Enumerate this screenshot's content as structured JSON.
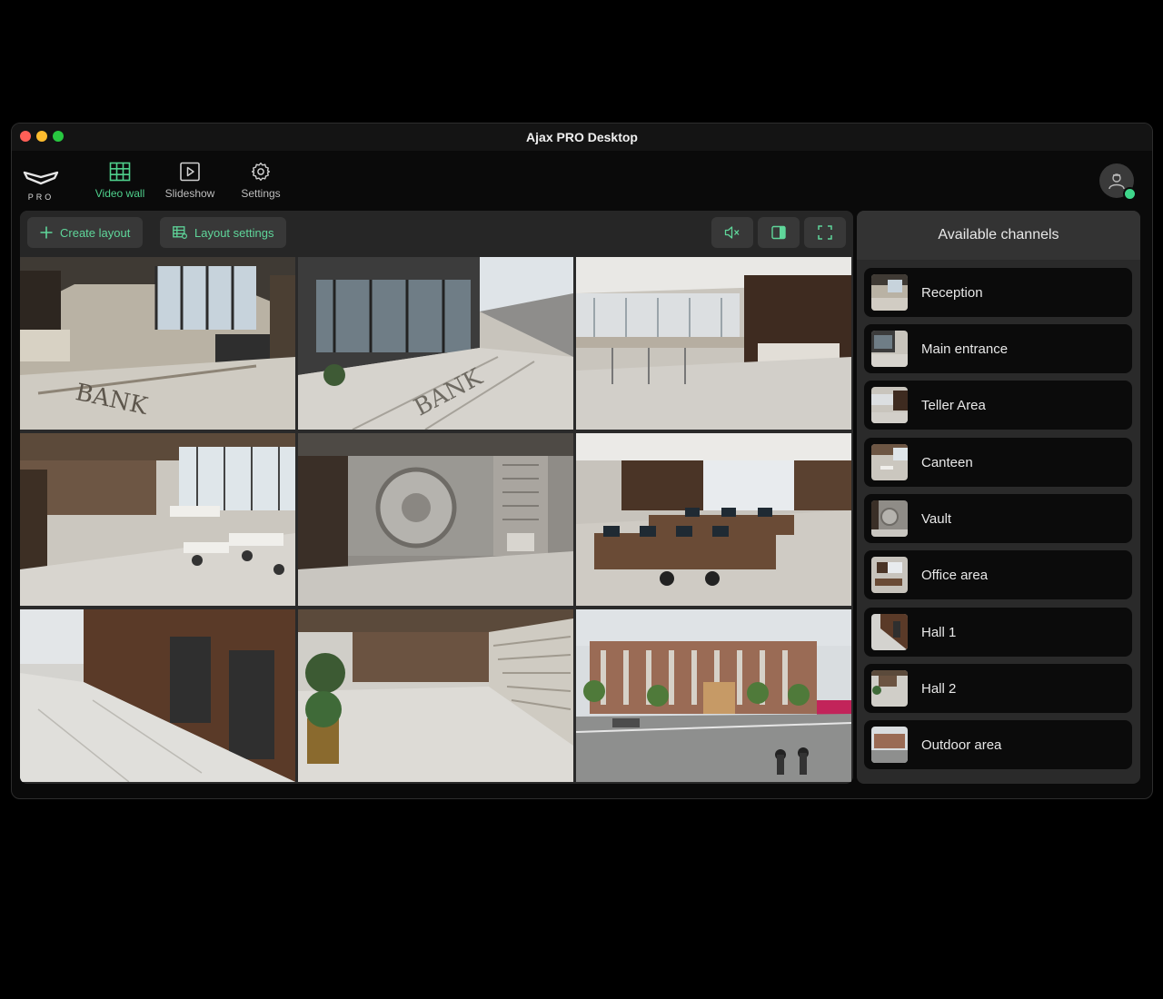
{
  "window": {
    "title": "Ajax PRO Desktop"
  },
  "logo": {
    "text": "PRO"
  },
  "nav": [
    {
      "label": "Video wall",
      "icon": "grid-icon",
      "active": true
    },
    {
      "label": "Slideshow",
      "icon": "play-icon",
      "active": false
    },
    {
      "label": "Settings",
      "icon": "gear-icon",
      "active": false
    }
  ],
  "toolbar": {
    "create_layout": "Create layout",
    "layout_settings": "Layout settings",
    "icons": [
      "mute-icon",
      "panel-toggle-icon",
      "fullscreen-icon"
    ]
  },
  "video_wall": {
    "columns": 3,
    "rows": 3,
    "feeds": [
      "Reception",
      "Main entrance",
      "Teller Area",
      "Canteen",
      "Vault",
      "Office area",
      "Hall 1",
      "Hall 2",
      "Outdoor area"
    ]
  },
  "sidebar": {
    "title": "Available channels",
    "channels": [
      {
        "label": "Reception"
      },
      {
        "label": "Main entrance"
      },
      {
        "label": "Teller Area"
      },
      {
        "label": "Canteen"
      },
      {
        "label": "Vault"
      },
      {
        "label": "Office area"
      },
      {
        "label": "Hall 1"
      },
      {
        "label": "Hall 2"
      },
      {
        "label": "Outdoor area"
      }
    ]
  },
  "colors": {
    "accent": "#4fd08c",
    "status_online": "#3ed68a"
  }
}
